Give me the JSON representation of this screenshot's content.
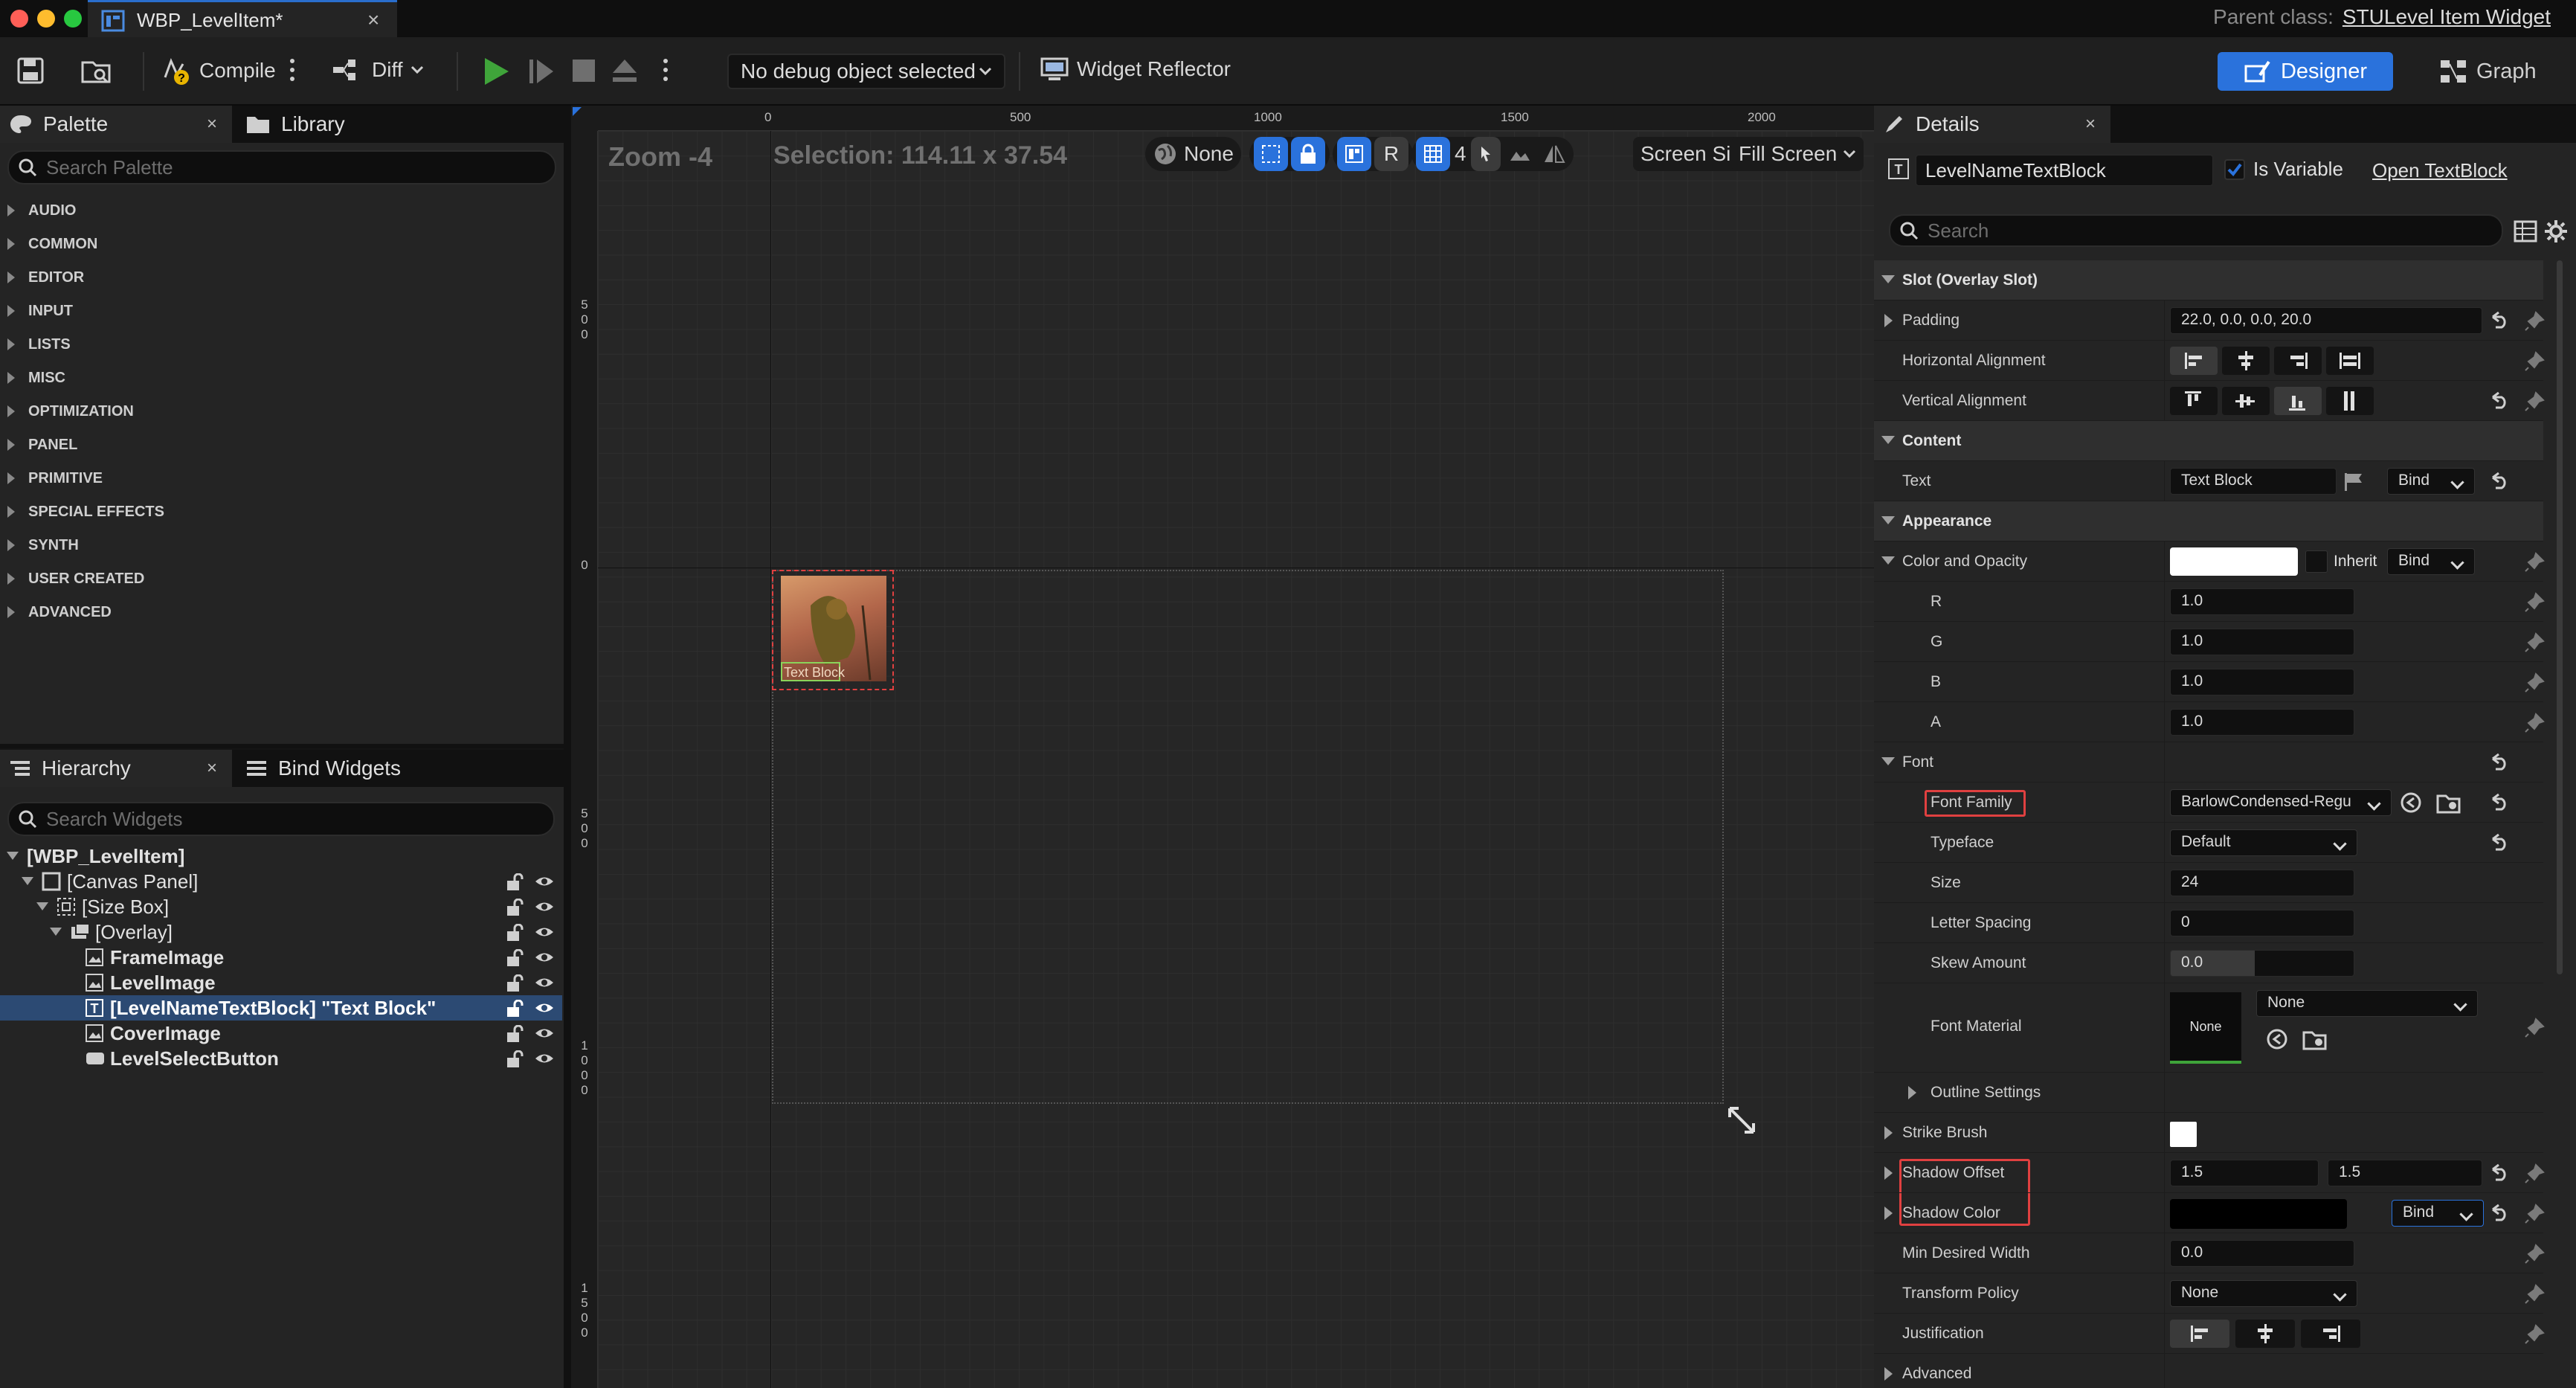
{
  "window": {
    "tab_title": "WBP_LevelItem*",
    "parent_class_label": "Parent class:",
    "parent_class_value": "STULevel Item Widget"
  },
  "toolbar": {
    "compile_label": "Compile",
    "diff_label": "Diff",
    "debug_object": "No debug object selected",
    "widget_reflector_label": "Widget Reflector",
    "designer_label": "Designer",
    "graph_label": "Graph"
  },
  "palette": {
    "tab_label": "Palette",
    "library_label": "Library",
    "search_placeholder": "Search Palette",
    "categories": [
      "AUDIO",
      "COMMON",
      "EDITOR",
      "INPUT",
      "LISTS",
      "MISC",
      "OPTIMIZATION",
      "PANEL",
      "PRIMITIVE",
      "SPECIAL EFFECTS",
      "SYNTH",
      "USER CREATED",
      "ADVANCED"
    ]
  },
  "hierarchy": {
    "tab_label": "Hierarchy",
    "bind_widgets_label": "Bind Widgets",
    "search_placeholder": "Search Widgets",
    "items": [
      {
        "label": "[WBP_LevelItem]"
      },
      {
        "label": "[Canvas Panel]"
      },
      {
        "label": "[Size Box]"
      },
      {
        "label": "[Overlay]"
      },
      {
        "label": "FrameImage"
      },
      {
        "label": "LevelImage"
      },
      {
        "label": "[LevelNameTextBlock] \"Text Block\""
      },
      {
        "label": "CoverImage"
      },
      {
        "label": "LevelSelectButton"
      }
    ]
  },
  "viewport": {
    "zoom": "Zoom -4",
    "selection": "Selection: 114.11 x 37.54",
    "none_label": "None",
    "r_label": "R",
    "grid_count": "4",
    "screen_size_label": "Screen Size",
    "fill_screen_label": "Fill Screen",
    "ruler_top": [
      "0",
      "500",
      "1000",
      "1500",
      "2000"
    ],
    "ruler_left": [
      "500",
      "0",
      "500",
      "1000",
      "1500"
    ],
    "widget_text": "Text Block"
  },
  "details": {
    "tab_label": "Details",
    "widget_name": "LevelNameTextBlock",
    "is_variable_label": "Is Variable",
    "open_link": "Open TextBlock",
    "search_placeholder": "Search",
    "slot_section": "Slot (Overlay Slot)",
    "padding_label": "Padding",
    "padding_value": "22.0, 0.0, 0.0, 20.0",
    "halign_label": "Horizontal Alignment",
    "valign_label": "Vertical Alignment",
    "content_section": "Content",
    "text_label": "Text",
    "text_value": "Text Block",
    "bind_label": "Bind",
    "appearance_section": "Appearance",
    "color_opacity_label": "Color and Opacity",
    "inherit_label": "Inherit",
    "r_label": "R",
    "r_value": "1.0",
    "g_label": "G",
    "g_value": "1.0",
    "b_label": "B",
    "b_value": "1.0",
    "a_label": "A",
    "a_value": "1.0",
    "font_label": "Font",
    "font_family_label": "Font Family",
    "font_family_value": "BarlowCondensed-Regu",
    "typeface_label": "Typeface",
    "typeface_value": "Default",
    "size_label": "Size",
    "size_value": "24",
    "letter_spacing_label": "Letter Spacing",
    "letter_spacing_value": "0",
    "skew_label": "Skew Amount",
    "skew_value": "0.0",
    "font_material_label": "Font Material",
    "font_material_thumb": "None",
    "font_material_value": "None",
    "outline_label": "Outline Settings",
    "strike_brush_label": "Strike Brush",
    "shadow_offset_label": "Shadow Offset",
    "shadow_offset_x": "1.5",
    "shadow_offset_y": "1.5",
    "shadow_color_label": "Shadow Color",
    "min_width_label": "Min Desired Width",
    "min_width_value": "0.0",
    "transform_policy_label": "Transform Policy",
    "transform_policy_value": "None",
    "justification_label": "Justification",
    "advanced_label": "Advanced"
  },
  "colors": {
    "accent_blue": "#2a72dc",
    "selection_red": "#e04040",
    "panel_bg": "#242424"
  }
}
